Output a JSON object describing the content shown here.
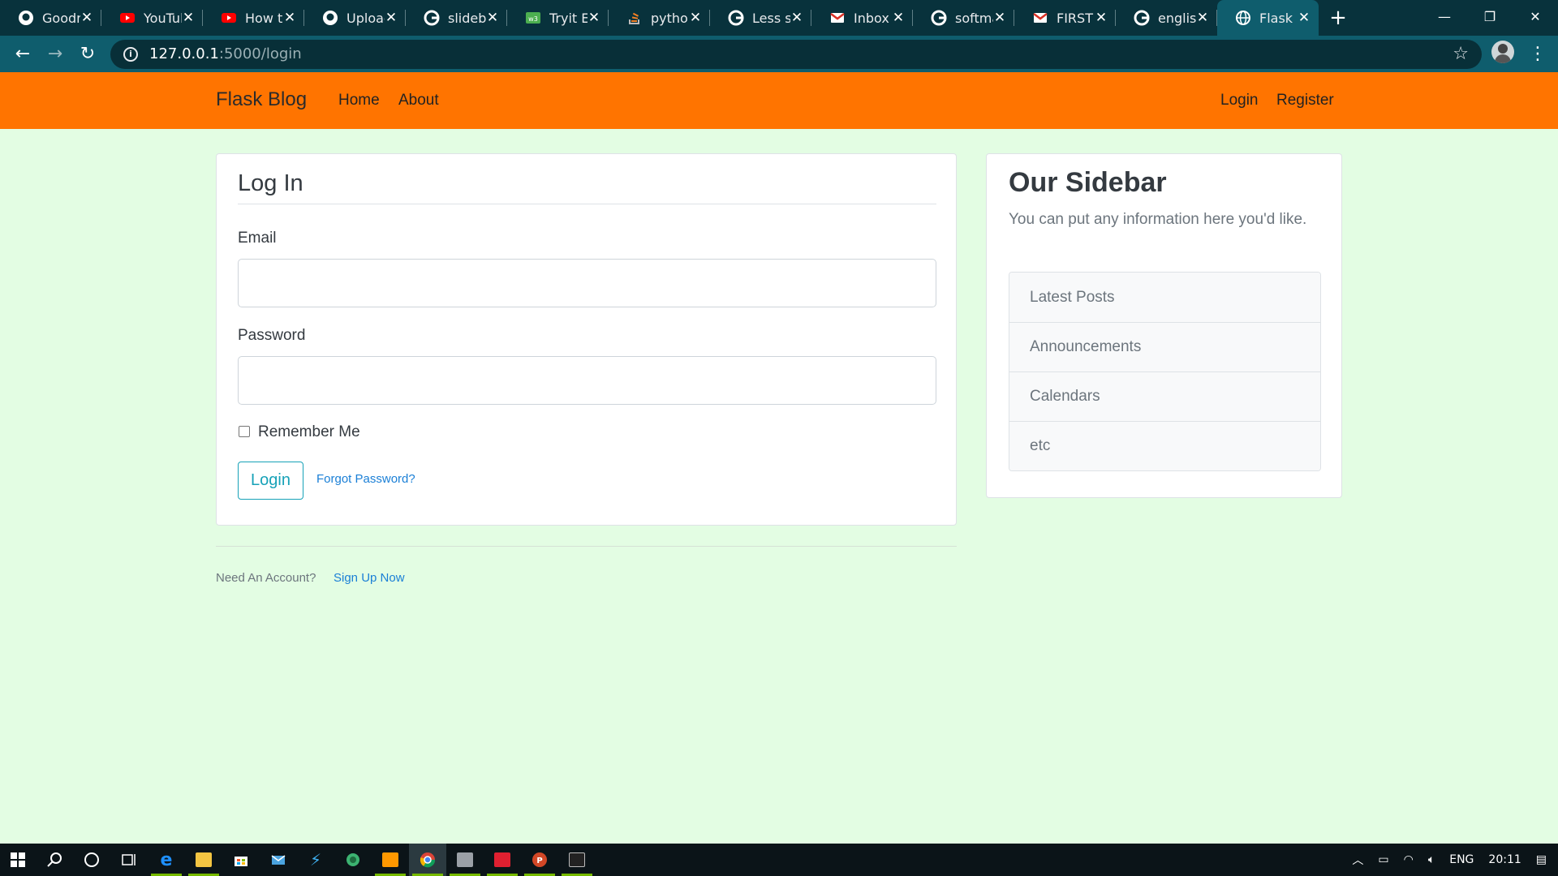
{
  "browser": {
    "tabs": [
      {
        "title": "Goodn",
        "icon": "github-icon"
      },
      {
        "title": "YouTub",
        "icon": "youtube-icon"
      },
      {
        "title": "How to",
        "icon": "youtube-icon"
      },
      {
        "title": "Upload",
        "icon": "github-icon"
      },
      {
        "title": "slideba",
        "icon": "google-icon"
      },
      {
        "title": "Tryit Ec",
        "icon": "w3schools-icon"
      },
      {
        "title": "python",
        "icon": "stackoverflow-icon"
      },
      {
        "title": "Less se",
        "icon": "google-icon"
      },
      {
        "title": "Inbox (",
        "icon": "gmail-icon"
      },
      {
        "title": "softma",
        "icon": "google-icon"
      },
      {
        "title": "FIRST I",
        "icon": "gmail-icon"
      },
      {
        "title": "english",
        "icon": "google-icon"
      },
      {
        "title": "Flask B",
        "icon": "globe-icon"
      }
    ],
    "url_host": "127.0.0.1",
    "url_path": ":5000/login"
  },
  "site": {
    "brand": "Flask Blog",
    "nav_left": [
      "Home",
      "About"
    ],
    "nav_right": [
      "Login",
      "Register"
    ],
    "colors": {
      "navbar": "#ff7400",
      "background": "#e3fde3",
      "accent": "#17a2b8",
      "link": "#1a7fd6"
    }
  },
  "login": {
    "legend": "Log In",
    "email_label": "Email",
    "email_value": "",
    "password_label": "Password",
    "password_value": "",
    "remember_label": "Remember Me",
    "submit_label": "Login",
    "forgot_label": "Forgot Password?",
    "need_account": "Need An Account?",
    "signup_label": "Sign Up Now"
  },
  "sidebar": {
    "title": "Our Sidebar",
    "text": "You can put any information here you'd like.",
    "items": [
      "Latest Posts",
      "Announcements",
      "Calendars",
      "etc"
    ]
  },
  "taskbar": {
    "language": "ENG",
    "time": "20:11"
  }
}
